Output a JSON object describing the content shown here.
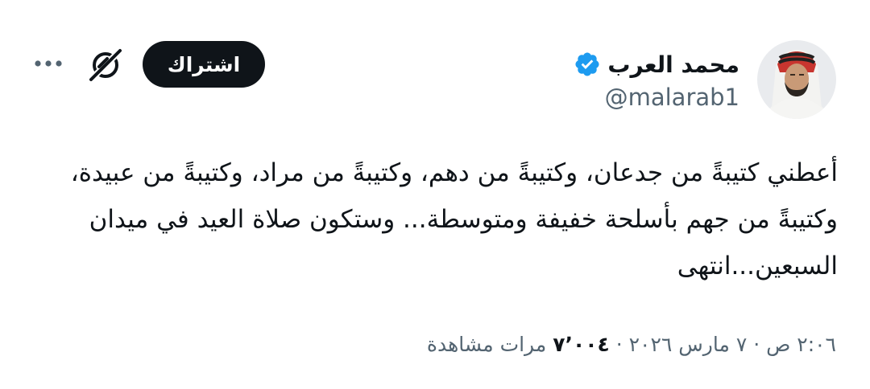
{
  "author": {
    "display_name": "محمد العرب",
    "handle": "@malarab1",
    "verified_icon": "verified-badge-icon"
  },
  "actions": {
    "subscribe_label": "اشتراك",
    "grok_icon": "grok-icon",
    "more_icon": "more-dots-icon"
  },
  "tweet": {
    "text": "أعطني كتيبةً من جدعان، وكتيبةً من دهم، وكتيبةً من مراد، وكتيبةً من عبيدة، وكتيبةً من جهم بأسلحة خفيفة ومتوسطة... وستكون صلاة العيد في ميدان السبعين...انتهى"
  },
  "meta": {
    "time": "٢:٠٦ ص",
    "separator": "·",
    "date": "٧ مارس ٢٠٢٦",
    "views_count": "٧٬٠٠٤",
    "views_label": "مرات مشاهدة"
  },
  "colors": {
    "text_primary": "#0f1419",
    "text_secondary": "#536471",
    "verified_blue": "#1d9bf0",
    "button_bg": "#0f1419"
  }
}
